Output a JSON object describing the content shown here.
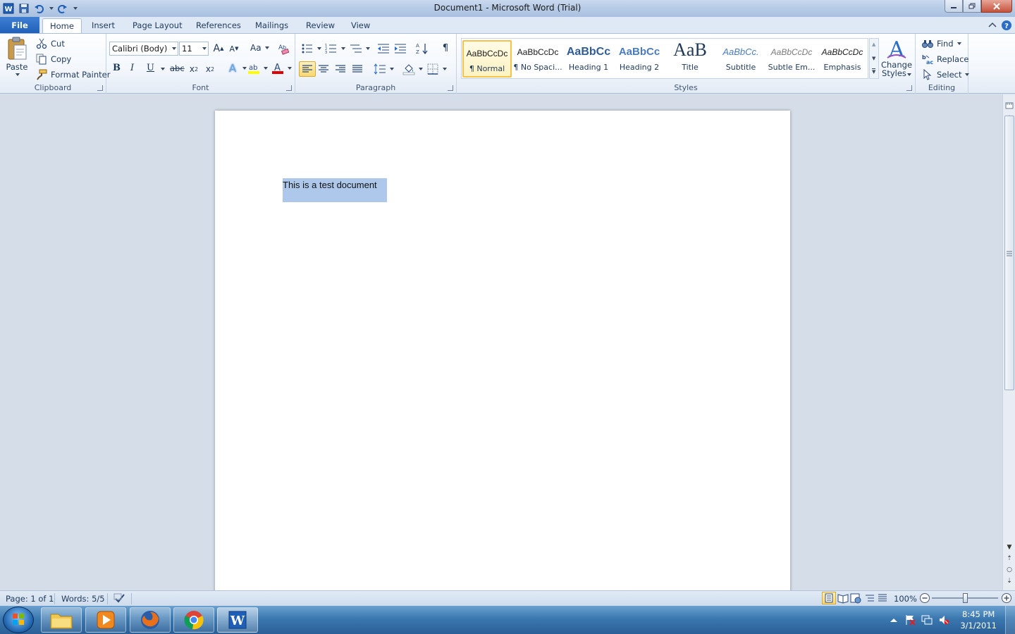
{
  "window": {
    "title": "Document1  -  Microsoft Word (Trial)"
  },
  "ribbon_tabs": [
    {
      "label": "File"
    },
    {
      "label": "Home"
    },
    {
      "label": "Insert"
    },
    {
      "label": "Page Layout"
    },
    {
      "label": "References"
    },
    {
      "label": "Mailings"
    },
    {
      "label": "Review"
    },
    {
      "label": "View"
    }
  ],
  "clipboard": {
    "group_label": "Clipboard",
    "paste_label": "Paste",
    "cut_label": "Cut",
    "copy_label": "Copy",
    "format_painter_label": "Format Painter"
  },
  "font": {
    "group_label": "Font",
    "font_name": "Calibri (Body)",
    "font_size": "11",
    "bold": "B",
    "italic": "I",
    "underline": "U",
    "strikethrough": "abc",
    "change_case": "Aa"
  },
  "paragraph": {
    "group_label": "Paragraph"
  },
  "styles": {
    "group_label": "Styles",
    "items": [
      {
        "preview": "AaBbCcDc",
        "name": "¶ Normal"
      },
      {
        "preview": "AaBbCcDc",
        "name": "¶ No Spaci..."
      },
      {
        "preview": "AaBbCc",
        "name": "Heading 1"
      },
      {
        "preview": "AaBbCc",
        "name": "Heading 2"
      },
      {
        "preview": "AaB",
        "name": "Title"
      },
      {
        "preview": "AaBbCc.",
        "name": "Subtitle"
      },
      {
        "preview": "AaBbCcDc",
        "name": "Subtle Em..."
      },
      {
        "preview": "AaBbCcDc",
        "name": "Emphasis"
      }
    ],
    "change_styles_line1": "Change",
    "change_styles_line2": "Styles"
  },
  "editing": {
    "group_label": "Editing",
    "find_label": "Find",
    "replace_label": "Replace",
    "select_label": "Select"
  },
  "document": {
    "text": "This is a test document"
  },
  "status": {
    "page": "Page: 1 of 1",
    "words": "Words: 5/5",
    "zoom": "100%"
  },
  "taskbar": {
    "time": "8:45 PM",
    "date": "3/1/2011"
  },
  "colors": {
    "file_tab": "#2b6cc4",
    "selection": "#adc8ea",
    "highlight_yellow": "#ffff00",
    "font_color_red": "#e00000"
  }
}
